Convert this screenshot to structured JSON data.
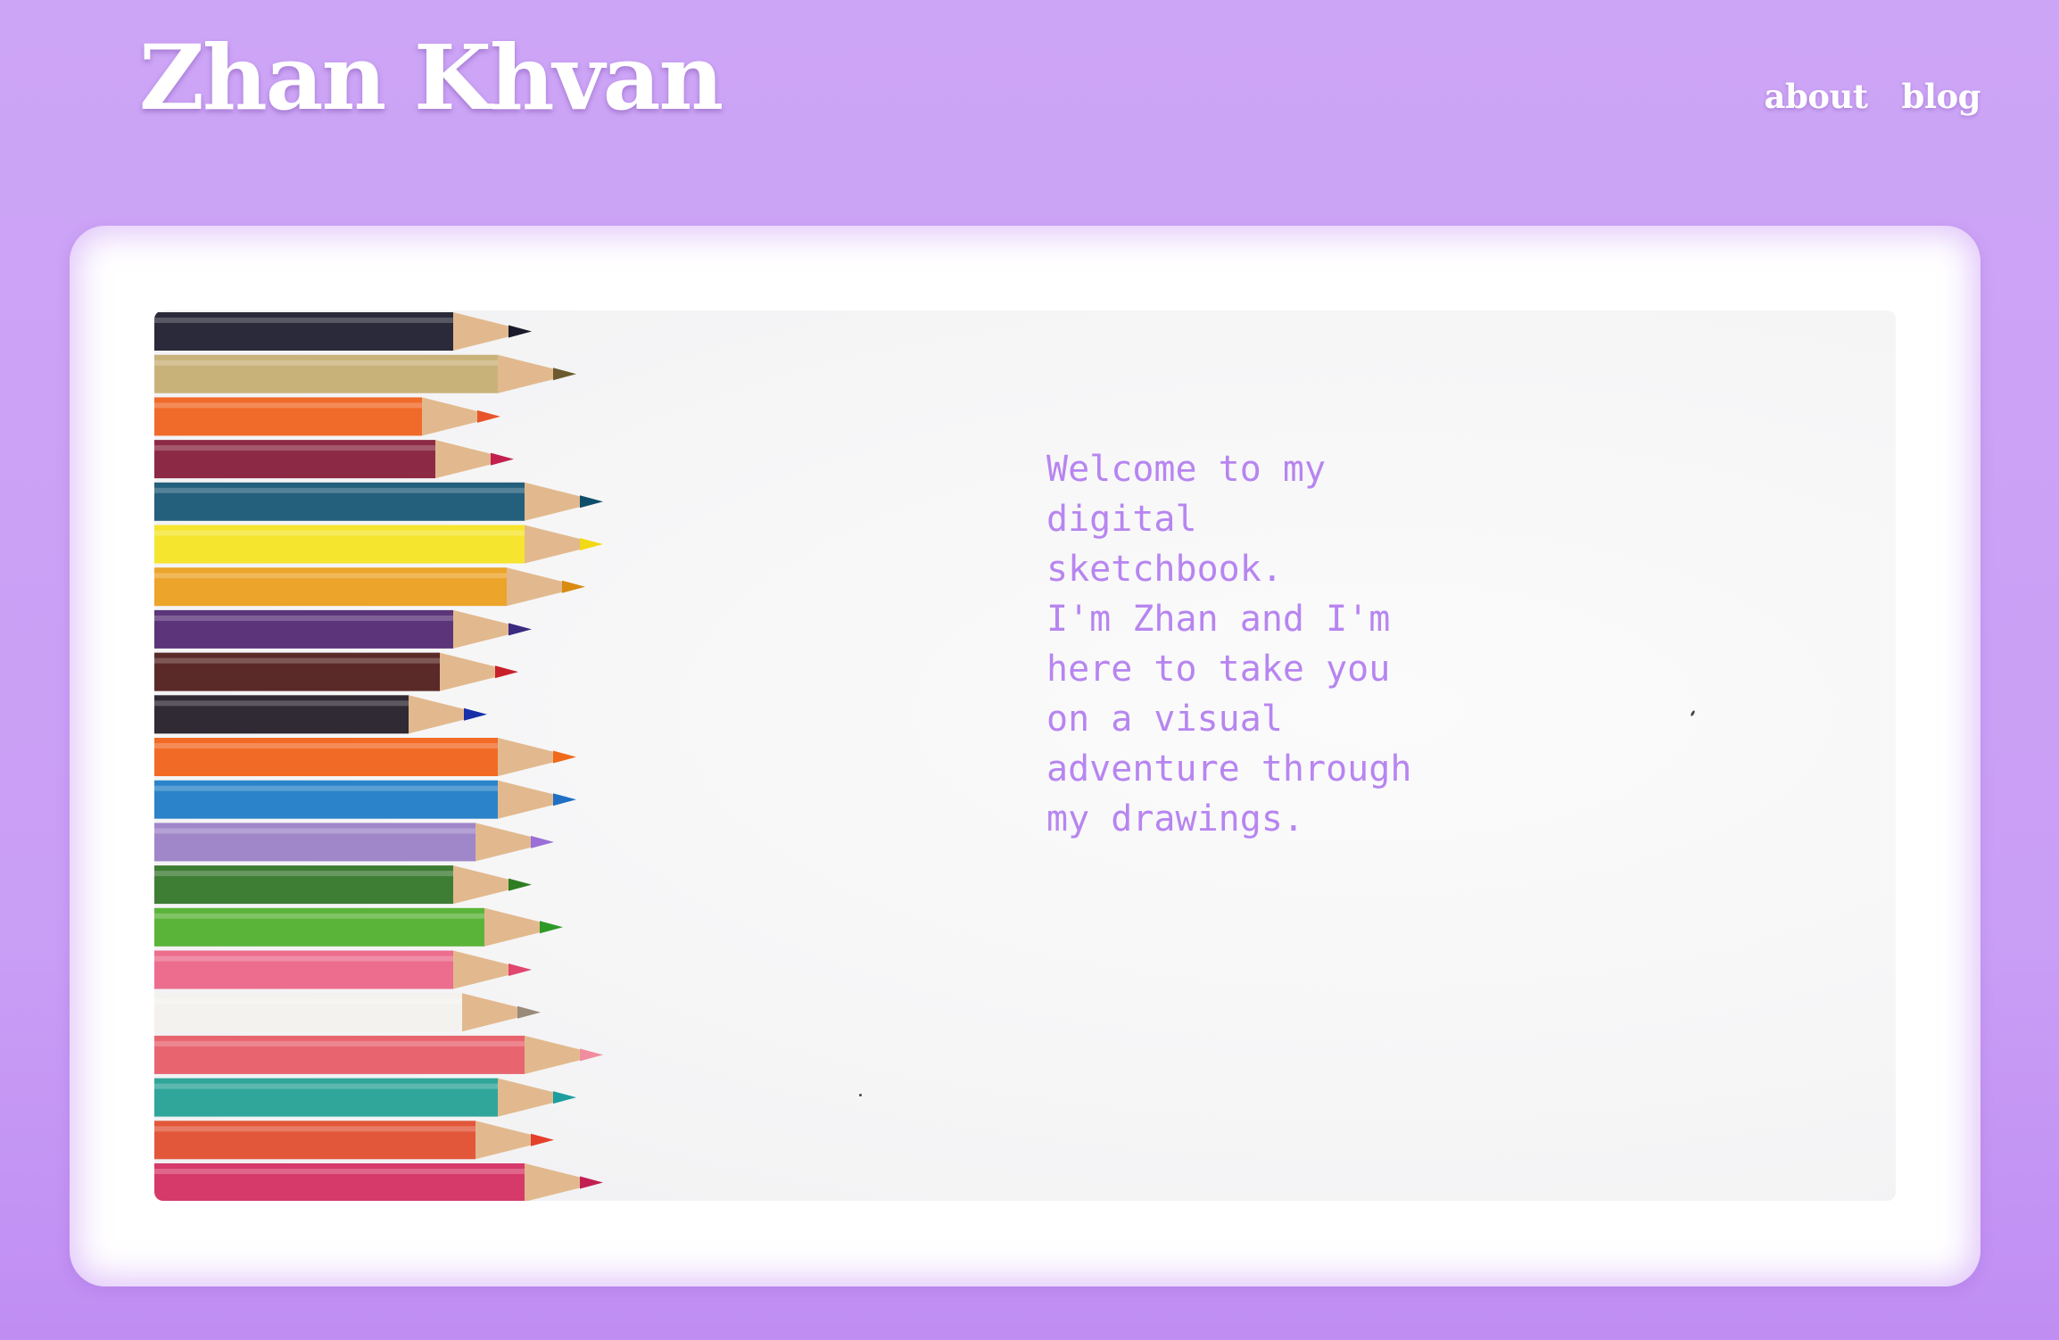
{
  "site": {
    "title": "Zhan Khvan"
  },
  "nav": {
    "items": [
      {
        "label": "about"
      },
      {
        "label": "blog"
      }
    ]
  },
  "hero": {
    "image_icon": "colored-pencils-image",
    "text": "Welcome to my\ndigital\nsketchbook.\nI'm Zhan and I'm\nhere to take you\non a visual\nadventure through\nmy drawings."
  },
  "colors": {
    "background": "#cda5f6",
    "accent_text": "#b785f0",
    "card": "#ffffff"
  }
}
